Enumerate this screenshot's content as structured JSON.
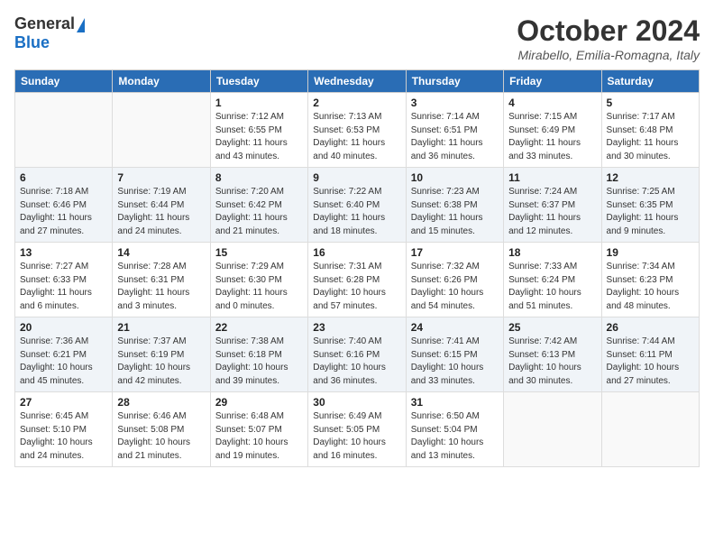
{
  "header": {
    "logo_general": "General",
    "logo_blue": "Blue",
    "month_title": "October 2024",
    "location": "Mirabello, Emilia-Romagna, Italy"
  },
  "days_of_week": [
    "Sunday",
    "Monday",
    "Tuesday",
    "Wednesday",
    "Thursday",
    "Friday",
    "Saturday"
  ],
  "weeks": [
    [
      {
        "day": "",
        "info": ""
      },
      {
        "day": "",
        "info": ""
      },
      {
        "day": "1",
        "info": "Sunrise: 7:12 AM\nSunset: 6:55 PM\nDaylight: 11 hours and 43 minutes."
      },
      {
        "day": "2",
        "info": "Sunrise: 7:13 AM\nSunset: 6:53 PM\nDaylight: 11 hours and 40 minutes."
      },
      {
        "day": "3",
        "info": "Sunrise: 7:14 AM\nSunset: 6:51 PM\nDaylight: 11 hours and 36 minutes."
      },
      {
        "day": "4",
        "info": "Sunrise: 7:15 AM\nSunset: 6:49 PM\nDaylight: 11 hours and 33 minutes."
      },
      {
        "day": "5",
        "info": "Sunrise: 7:17 AM\nSunset: 6:48 PM\nDaylight: 11 hours and 30 minutes."
      }
    ],
    [
      {
        "day": "6",
        "info": "Sunrise: 7:18 AM\nSunset: 6:46 PM\nDaylight: 11 hours and 27 minutes."
      },
      {
        "day": "7",
        "info": "Sunrise: 7:19 AM\nSunset: 6:44 PM\nDaylight: 11 hours and 24 minutes."
      },
      {
        "day": "8",
        "info": "Sunrise: 7:20 AM\nSunset: 6:42 PM\nDaylight: 11 hours and 21 minutes."
      },
      {
        "day": "9",
        "info": "Sunrise: 7:22 AM\nSunset: 6:40 PM\nDaylight: 11 hours and 18 minutes."
      },
      {
        "day": "10",
        "info": "Sunrise: 7:23 AM\nSunset: 6:38 PM\nDaylight: 11 hours and 15 minutes."
      },
      {
        "day": "11",
        "info": "Sunrise: 7:24 AM\nSunset: 6:37 PM\nDaylight: 11 hours and 12 minutes."
      },
      {
        "day": "12",
        "info": "Sunrise: 7:25 AM\nSunset: 6:35 PM\nDaylight: 11 hours and 9 minutes."
      }
    ],
    [
      {
        "day": "13",
        "info": "Sunrise: 7:27 AM\nSunset: 6:33 PM\nDaylight: 11 hours and 6 minutes."
      },
      {
        "day": "14",
        "info": "Sunrise: 7:28 AM\nSunset: 6:31 PM\nDaylight: 11 hours and 3 minutes."
      },
      {
        "day": "15",
        "info": "Sunrise: 7:29 AM\nSunset: 6:30 PM\nDaylight: 11 hours and 0 minutes."
      },
      {
        "day": "16",
        "info": "Sunrise: 7:31 AM\nSunset: 6:28 PM\nDaylight: 10 hours and 57 minutes."
      },
      {
        "day": "17",
        "info": "Sunrise: 7:32 AM\nSunset: 6:26 PM\nDaylight: 10 hours and 54 minutes."
      },
      {
        "day": "18",
        "info": "Sunrise: 7:33 AM\nSunset: 6:24 PM\nDaylight: 10 hours and 51 minutes."
      },
      {
        "day": "19",
        "info": "Sunrise: 7:34 AM\nSunset: 6:23 PM\nDaylight: 10 hours and 48 minutes."
      }
    ],
    [
      {
        "day": "20",
        "info": "Sunrise: 7:36 AM\nSunset: 6:21 PM\nDaylight: 10 hours and 45 minutes."
      },
      {
        "day": "21",
        "info": "Sunrise: 7:37 AM\nSunset: 6:19 PM\nDaylight: 10 hours and 42 minutes."
      },
      {
        "day": "22",
        "info": "Sunrise: 7:38 AM\nSunset: 6:18 PM\nDaylight: 10 hours and 39 minutes."
      },
      {
        "day": "23",
        "info": "Sunrise: 7:40 AM\nSunset: 6:16 PM\nDaylight: 10 hours and 36 minutes."
      },
      {
        "day": "24",
        "info": "Sunrise: 7:41 AM\nSunset: 6:15 PM\nDaylight: 10 hours and 33 minutes."
      },
      {
        "day": "25",
        "info": "Sunrise: 7:42 AM\nSunset: 6:13 PM\nDaylight: 10 hours and 30 minutes."
      },
      {
        "day": "26",
        "info": "Sunrise: 7:44 AM\nSunset: 6:11 PM\nDaylight: 10 hours and 27 minutes."
      }
    ],
    [
      {
        "day": "27",
        "info": "Sunrise: 6:45 AM\nSunset: 5:10 PM\nDaylight: 10 hours and 24 minutes."
      },
      {
        "day": "28",
        "info": "Sunrise: 6:46 AM\nSunset: 5:08 PM\nDaylight: 10 hours and 21 minutes."
      },
      {
        "day": "29",
        "info": "Sunrise: 6:48 AM\nSunset: 5:07 PM\nDaylight: 10 hours and 19 minutes."
      },
      {
        "day": "30",
        "info": "Sunrise: 6:49 AM\nSunset: 5:05 PM\nDaylight: 10 hours and 16 minutes."
      },
      {
        "day": "31",
        "info": "Sunrise: 6:50 AM\nSunset: 5:04 PM\nDaylight: 10 hours and 13 minutes."
      },
      {
        "day": "",
        "info": ""
      },
      {
        "day": "",
        "info": ""
      }
    ]
  ]
}
